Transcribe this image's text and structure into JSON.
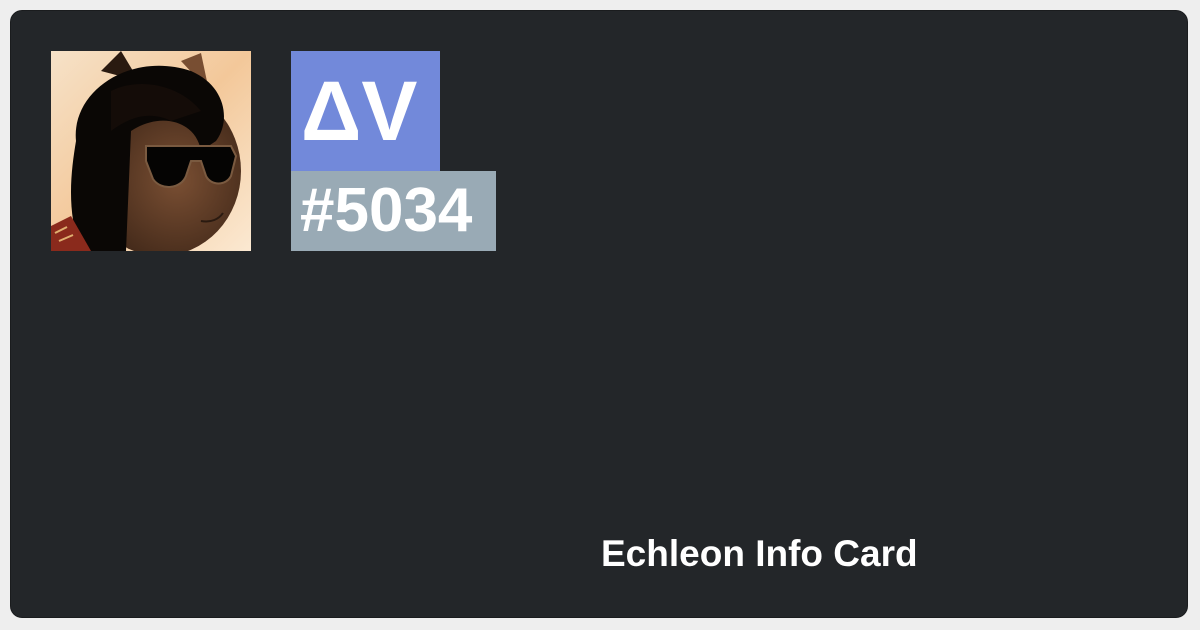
{
  "card": {
    "name_tag": "ΔV",
    "discriminator": "#5034",
    "footer_title": "Echleon Info Card"
  },
  "colors": {
    "card_background": "#232629",
    "name_tag_background": "#7289da",
    "discriminator_background": "#99aab5",
    "text": "#ffffff"
  },
  "avatar": {
    "icon": "user-avatar-image"
  }
}
